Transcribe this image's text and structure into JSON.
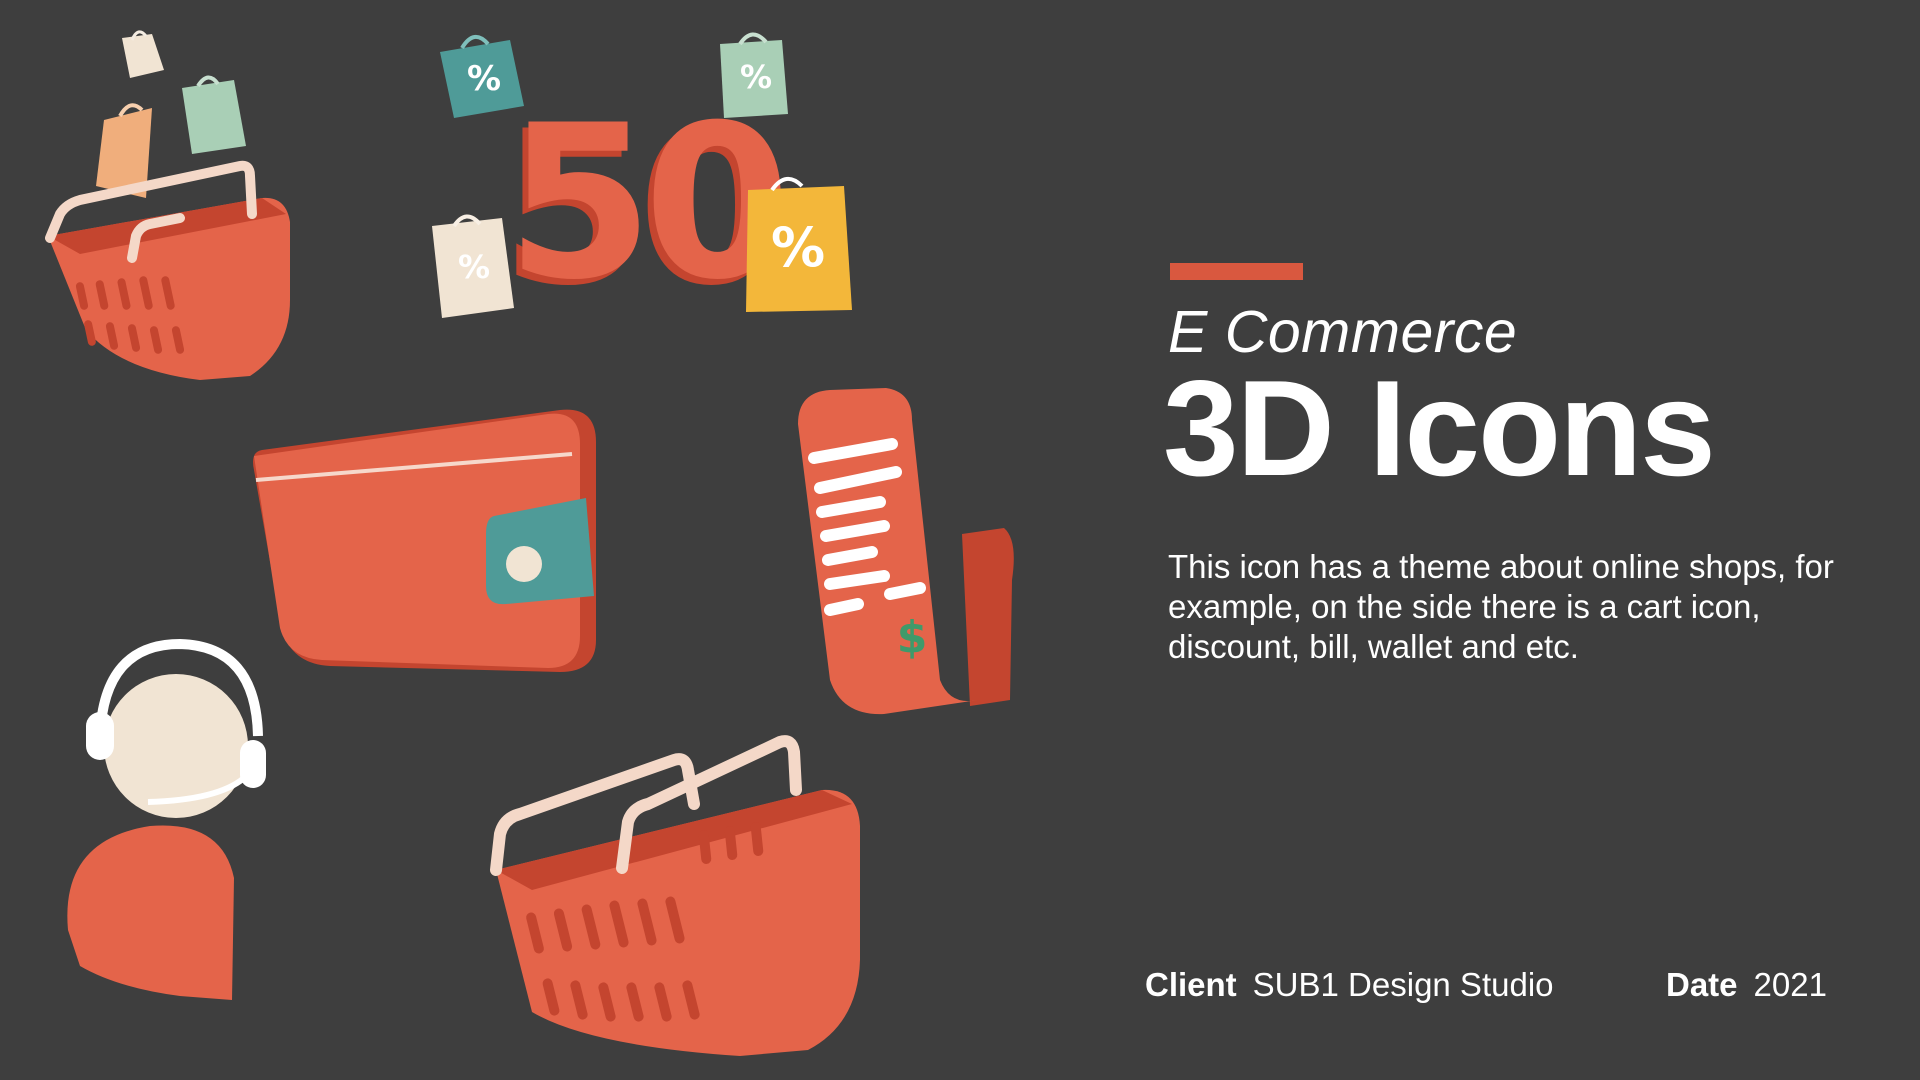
{
  "colors": {
    "background": "#3e3e3e",
    "accent": "#d9583f",
    "icon_primary": "#e4644a",
    "icon_dark": "#c4452f",
    "teal": "#4f9b98",
    "mint": "#a9cfb6",
    "cream": "#f1e4d3",
    "peach": "#f0ae7c",
    "yellow": "#f3b73a",
    "white": "#ffffff"
  },
  "icons": [
    "shopping-basket-icon",
    "shopping-bag-icon",
    "discount-bag-icon",
    "fifty-percent-icon",
    "wallet-icon",
    "receipt-bill-icon",
    "customer-service-icon"
  ],
  "art": {
    "discount_number": "50",
    "percent_symbol": "%",
    "dollar_symbol": "$"
  },
  "hero": {
    "eyebrow": "E Commerce",
    "title": "3D Icons",
    "description": "This icon has a theme about online shops, for example, on the side there is a cart icon, discount, bill, wallet and etc."
  },
  "footer": {
    "client_label": "Client",
    "client_value": "SUB1 Design Studio",
    "date_label": "Date",
    "date_value": "2021"
  }
}
